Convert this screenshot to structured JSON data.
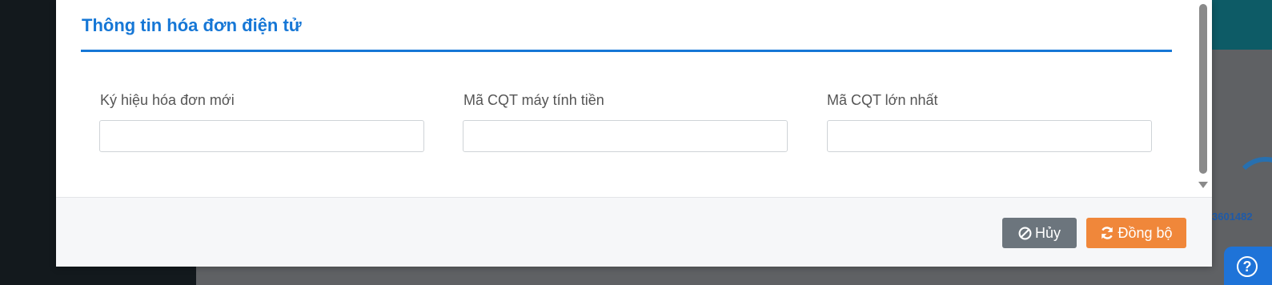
{
  "background": {
    "number_text": "3601482",
    "help_icon": "question-circle-icon"
  },
  "modal": {
    "section_title": "Thông tin hóa đơn điện tử",
    "fields": [
      {
        "label": "Ký hiệu hóa đơn mới",
        "value": "",
        "placeholder": ""
      },
      {
        "label": "Mã CQT máy tính tiền",
        "value": "",
        "placeholder": ""
      },
      {
        "label": "Mã CQT lớn nhất",
        "value": "",
        "placeholder": ""
      }
    ],
    "buttons": {
      "cancel_label": "Hủy",
      "cancel_icon": "ban-icon",
      "sync_label": "Đồng bộ",
      "sync_icon": "refresh-icon"
    }
  },
  "colors": {
    "accent": "#1677d6",
    "cancel": "#6c757d",
    "sync": "#f0873a"
  }
}
